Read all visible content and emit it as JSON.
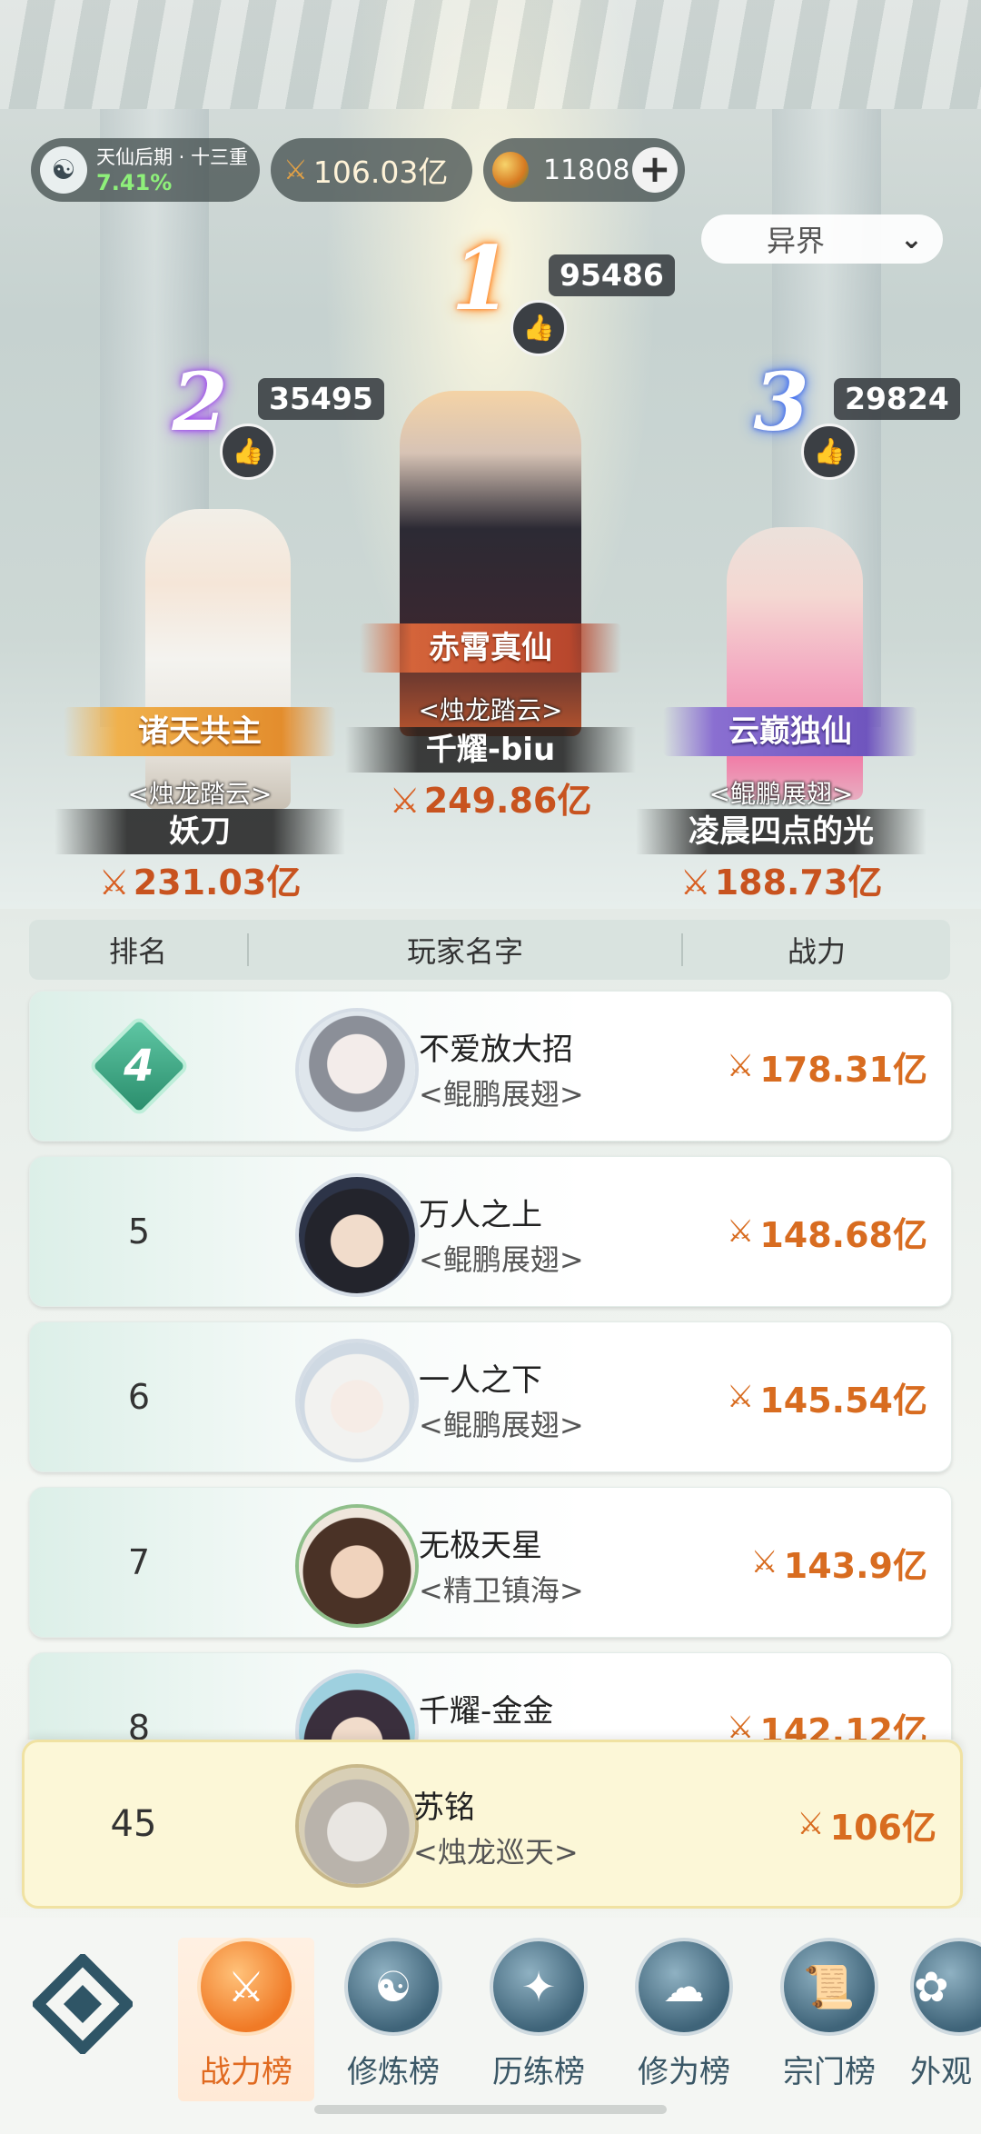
{
  "topbar": {
    "realm_stage": "天仙后期 · 十三重",
    "realm_progress": "7.41%",
    "power": "106.03亿",
    "spirit_count": "11808",
    "add_icon": "plus-icon",
    "server_select": "异界"
  },
  "podium": [
    {
      "rank": "1",
      "likes": "95486",
      "title": "赤霄真仙",
      "sect": "<烛龙踏云>",
      "name": "千耀-biu",
      "power": "249.86亿"
    },
    {
      "rank": "2",
      "likes": "35495",
      "title": "诸天共主",
      "sect": "<烛龙踏云>",
      "name": "妖刀",
      "power": "231.03亿"
    },
    {
      "rank": "3",
      "likes": "29824",
      "title": "云巅独仙",
      "sect": "<鲲鹏展翅>",
      "name": "凌晨四点的光",
      "power": "188.73亿"
    }
  ],
  "table": {
    "headers": [
      "排名",
      "玩家名字",
      "战力"
    ],
    "rows": [
      {
        "rank": "4",
        "name": "不爱放大招",
        "sect": "<鲲鹏展翅>",
        "power": "178.31亿"
      },
      {
        "rank": "5",
        "name": "万人之上",
        "sect": "<鲲鹏展翅>",
        "power": "148.68亿"
      },
      {
        "rank": "6",
        "name": "一人之下",
        "sect": "<鲲鹏展翅>",
        "power": "145.54亿"
      },
      {
        "rank": "7",
        "name": "无极天星",
        "sect": "<精卫镇海>",
        "power": "143.9亿"
      },
      {
        "rank": "8",
        "name": "千耀-金金",
        "sect": "",
        "power": "142.12亿"
      }
    ]
  },
  "my_rank": {
    "rank": "45",
    "name": "苏铭",
    "sect": "<烛龙巡天>",
    "power": "106亿"
  },
  "nav": {
    "items": [
      {
        "label": "战力榜",
        "icon": "crossed-swords-icon",
        "active": true
      },
      {
        "label": "修炼榜",
        "icon": "yin-yang-icon"
      },
      {
        "label": "历练榜",
        "icon": "star-compass-icon"
      },
      {
        "label": "修为榜",
        "icon": "meditation-icon"
      },
      {
        "label": "宗门榜",
        "icon": "scroll-icon"
      },
      {
        "label": "外观",
        "icon": "outfit-icon"
      }
    ]
  },
  "colors": {
    "accent": "#d86c20",
    "active_nav": "#e06a20",
    "rank_badge": "#2a8d6c",
    "me_row_bg": "#fcf7d7"
  }
}
